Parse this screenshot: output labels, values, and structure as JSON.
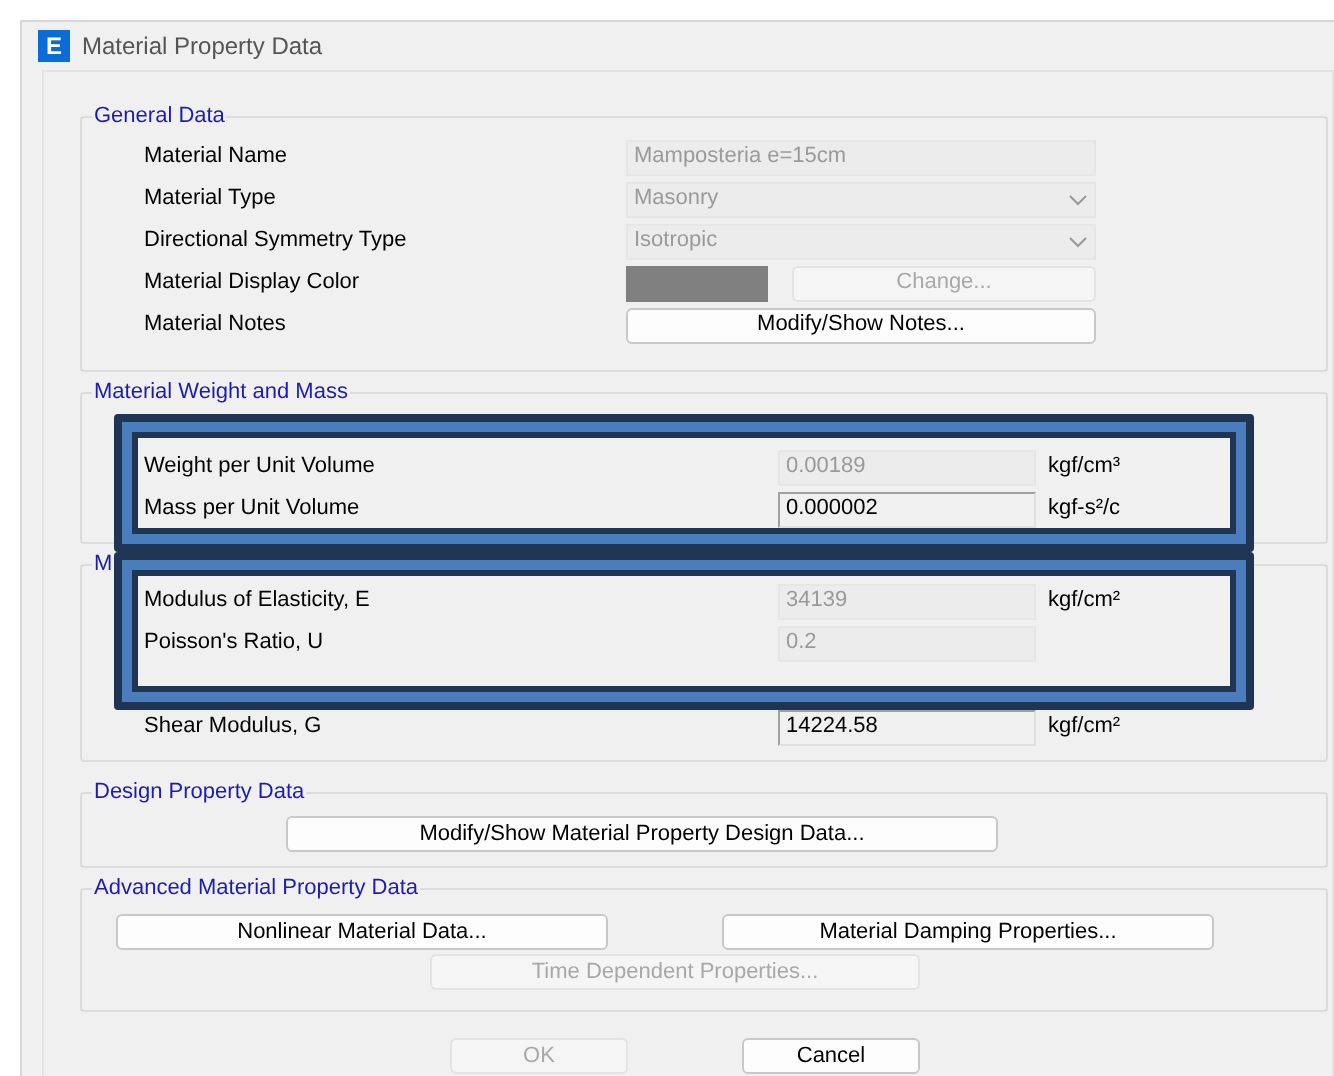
{
  "window": {
    "title": "Material Property Data",
    "app_icon": "E"
  },
  "general": {
    "title": "General Data",
    "rows": [
      {
        "label": "Material Name",
        "kind": "text",
        "value": "Mamposteria e=15cm",
        "disabled": true
      },
      {
        "label": "Material Type",
        "kind": "dropdown",
        "value": "Masonry",
        "disabled": true
      },
      {
        "label": "Directional Symmetry Type",
        "kind": "dropdown",
        "value": "Isotropic",
        "disabled": true
      },
      {
        "label": "Material Display Color",
        "kind": "color",
        "color": "#808080",
        "button": "Change...",
        "disabled": true
      },
      {
        "label": "Material Notes",
        "kind": "button",
        "button": "Modify/Show Notes...",
        "disabled": false
      }
    ]
  },
  "weight": {
    "title": "Material Weight and Mass",
    "rows": [
      {
        "label": "Weight per Unit Volume",
        "value": "0.00189",
        "unit": "kgf/cm³",
        "disabled": true
      },
      {
        "label": "Mass per Unit Volume",
        "value": "0.000002",
        "unit": "kgf-s²/c",
        "disabled": false
      }
    ]
  },
  "mechanical": {
    "title": "M",
    "rows": [
      {
        "label": "Modulus of Elasticity,  E",
        "value": "34139",
        "unit": "kgf/cm²",
        "disabled": true
      },
      {
        "label": "Poisson's Ratio,  U",
        "value": "0.2",
        "disabled": true
      },
      {
        "label": "Shear Modulus,  G",
        "value": "14224.58",
        "unit": "kgf/cm²",
        "disabled": false
      }
    ]
  },
  "design": {
    "title": "Design Property Data",
    "button": "Modify/Show Material Property Design Data..."
  },
  "advanced": {
    "title": "Advanced Material Property Data",
    "buttons": [
      {
        "label": "Nonlinear Material Data...",
        "disabled": false
      },
      {
        "label": "Material Damping Properties...",
        "disabled": false
      },
      {
        "label": "Time Dependent Properties...",
        "disabled": true
      }
    ]
  },
  "buttons": [
    {
      "label": "OK",
      "disabled": true
    },
    {
      "label": "Cancel",
      "disabled": false
    }
  ]
}
